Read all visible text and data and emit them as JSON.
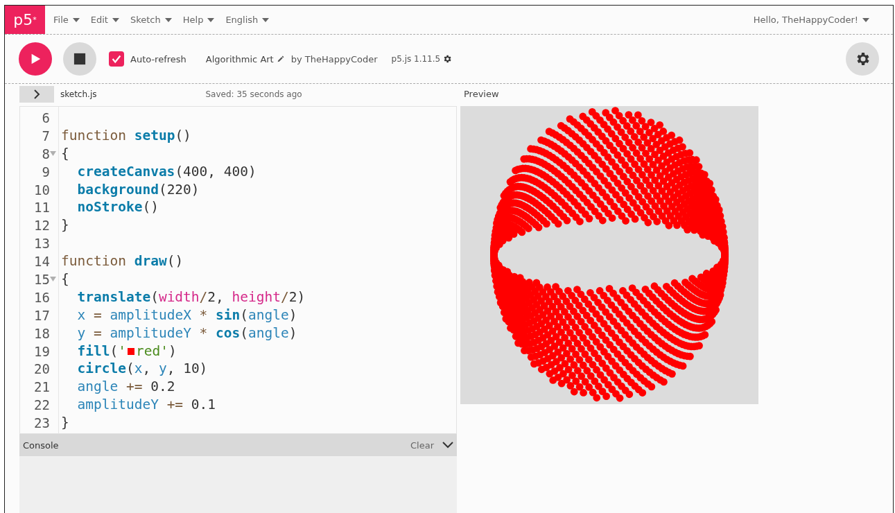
{
  "menubar": {
    "logo": "p5$^{*}$",
    "menus": [
      {
        "label": "File"
      },
      {
        "label": "Edit"
      },
      {
        "label": "Sketch"
      },
      {
        "label": "Help"
      },
      {
        "label": "English"
      }
    ],
    "user_menu": "Hello, TheHappyCoder!"
  },
  "toolbar": {
    "auto_refresh": {
      "label": "Auto-refresh",
      "checked": true
    },
    "sketch_name": "Algorithmic Art",
    "author": "by TheHappyCoder",
    "version": "p5.js 1.11.5"
  },
  "editor": {
    "sidebar_expanded": false,
    "file_tab": "sketch.js",
    "saved_status": "Saved: 35 seconds ago",
    "lines": [
      {
        "number": "6",
        "foldable": false
      },
      {
        "number": "7",
        "foldable": false,
        "tokens": [
          {
            "kind": "kw",
            "text": "function "
          },
          {
            "kind": "def",
            "text": "setup"
          },
          {
            "kind": "punct",
            "text": "()"
          }
        ]
      },
      {
        "number": "8",
        "foldable": true,
        "tokens": [
          {
            "kind": "punct",
            "text": "{"
          }
        ]
      },
      {
        "number": "9",
        "foldable": false,
        "tokens": [
          {
            "kind": "fn",
            "text": "  createCanvas"
          },
          {
            "kind": "punct",
            "text": "(400, 400)"
          }
        ]
      },
      {
        "number": "10",
        "foldable": false,
        "tokens": [
          {
            "kind": "fn",
            "text": "  background"
          },
          {
            "kind": "punct",
            "text": "(220)"
          }
        ]
      },
      {
        "number": "11",
        "foldable": false,
        "tokens": [
          {
            "kind": "fn",
            "text": "  noStroke"
          },
          {
            "kind": "punct",
            "text": "()"
          }
        ]
      },
      {
        "number": "12",
        "foldable": false,
        "tokens": [
          {
            "kind": "punct",
            "text": "}"
          }
        ]
      },
      {
        "number": "13",
        "foldable": false
      },
      {
        "number": "14",
        "foldable": false,
        "tokens": [
          {
            "kind": "kw",
            "text": "function "
          },
          {
            "kind": "def",
            "text": "draw"
          },
          {
            "kind": "punct",
            "text": "()"
          }
        ]
      },
      {
        "number": "15",
        "foldable": true,
        "tokens": [
          {
            "kind": "punct",
            "text": "{"
          }
        ]
      },
      {
        "number": "16",
        "foldable": false,
        "tokens": [
          {
            "kind": "fn",
            "text": "  translate"
          },
          {
            "kind": "punct",
            "text": "("
          },
          {
            "kind": "prm",
            "text": "width"
          },
          {
            "kind": "op",
            "text": "/"
          },
          {
            "kind": "punct",
            "text": "2, "
          },
          {
            "kind": "prm",
            "text": "height"
          },
          {
            "kind": "op",
            "text": "/"
          },
          {
            "kind": "punct",
            "text": "2)"
          }
        ]
      },
      {
        "number": "17",
        "foldable": false,
        "tokens": [
          {
            "kind": "var",
            "text": "  x"
          },
          {
            "kind": "op",
            "text": " = "
          },
          {
            "kind": "var",
            "text": "amplitudeX"
          },
          {
            "kind": "op",
            "text": " * "
          },
          {
            "kind": "fn",
            "text": "sin"
          },
          {
            "kind": "punct",
            "text": "("
          },
          {
            "kind": "var",
            "text": "angle"
          },
          {
            "kind": "punct",
            "text": ")"
          }
        ]
      },
      {
        "number": "18",
        "foldable": false,
        "tokens": [
          {
            "kind": "var",
            "text": "  y"
          },
          {
            "kind": "op",
            "text": " = "
          },
          {
            "kind": "var",
            "text": "amplitudeY"
          },
          {
            "kind": "op",
            "text": " * "
          },
          {
            "kind": "fn",
            "text": "cos"
          },
          {
            "kind": "punct",
            "text": "("
          },
          {
            "kind": "var",
            "text": "angle"
          },
          {
            "kind": "punct",
            "text": ")"
          }
        ]
      },
      {
        "number": "19",
        "foldable": false,
        "tokens": [
          {
            "kind": "fn",
            "text": "  fill"
          },
          {
            "kind": "punct",
            "text": "("
          },
          {
            "kind": "str",
            "text": "'"
          },
          {
            "kind": "swatch",
            "color": "#ff0000"
          },
          {
            "kind": "str",
            "text": "red'"
          },
          {
            "kind": "punct",
            "text": ")"
          }
        ]
      },
      {
        "number": "20",
        "foldable": false,
        "tokens": [
          {
            "kind": "fn",
            "text": "  circle"
          },
          {
            "kind": "punct",
            "text": "("
          },
          {
            "kind": "var",
            "text": "x"
          },
          {
            "kind": "punct",
            "text": ", "
          },
          {
            "kind": "var",
            "text": "y"
          },
          {
            "kind": "punct",
            "text": ", 10)"
          }
        ]
      },
      {
        "number": "21",
        "foldable": false,
        "tokens": [
          {
            "kind": "var",
            "text": "  angle"
          },
          {
            "kind": "op",
            "text": " += "
          },
          {
            "kind": "punct",
            "text": "0.2"
          }
        ]
      },
      {
        "number": "22",
        "foldable": false,
        "tokens": [
          {
            "kind": "var",
            "text": "  amplitudeY"
          },
          {
            "kind": "op",
            "text": " += "
          },
          {
            "kind": "punct",
            "text": "0.1"
          }
        ]
      },
      {
        "number": "23",
        "foldable": false,
        "tokens": [
          {
            "kind": "punct",
            "text": "}"
          }
        ]
      }
    ]
  },
  "console": {
    "title": "Console",
    "clear": "Clear"
  },
  "preview": {
    "title": "Preview"
  }
}
